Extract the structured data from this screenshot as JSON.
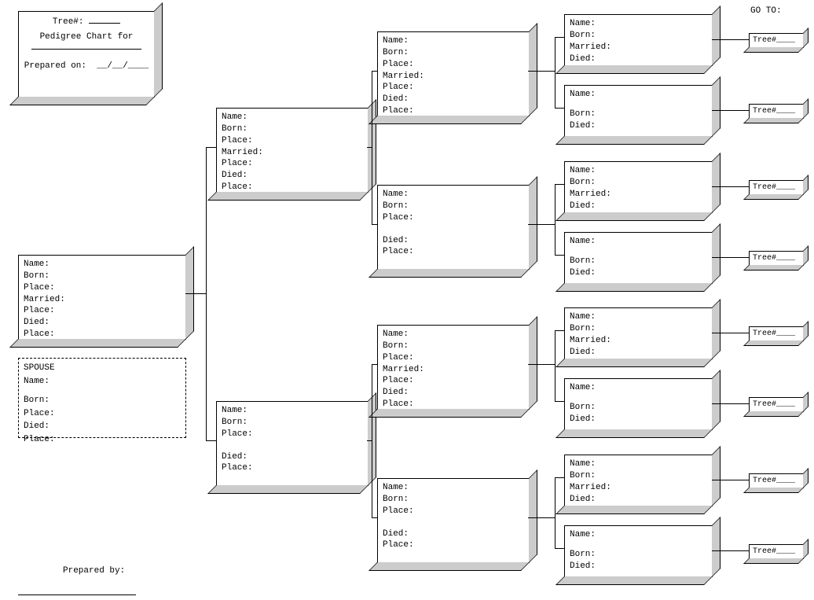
{
  "header": {
    "tree_no_label": "Tree#:",
    "title": "Pedigree Chart for",
    "prepared_on": "Prepared on:",
    "date_sep": "__/__/____"
  },
  "go_to": "GO TO:",
  "fields": {
    "name": "Name:",
    "born": "Born:",
    "place": "Place:",
    "married": "Married:",
    "died": "Died:",
    "spouse": "SPOUSE"
  },
  "tree_label": "Tree#____",
  "footer": {
    "prepared_by": "Prepared by:"
  }
}
